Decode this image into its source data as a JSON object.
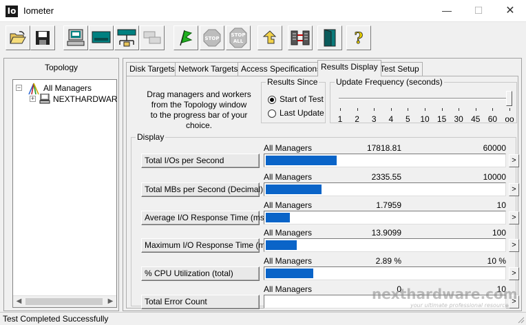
{
  "window": {
    "app_icon_text": "Io",
    "title": "Iometer",
    "minimize": "—",
    "maximize": "☐",
    "close": "✕"
  },
  "toolbar": {
    "buttons": [
      {
        "name": "open-config-button",
        "icon": "open-folder-icon"
      },
      {
        "name": "save-config-button",
        "icon": "floppy-disk-icon"
      },
      {
        "name": "new-manager-button",
        "icon": "computer-icon"
      },
      {
        "name": "new-disk-worker-button",
        "icon": "disk-worker-icon"
      },
      {
        "name": "new-network-worker-button",
        "icon": "network-worker-icon"
      },
      {
        "name": "duplicate-worker-button",
        "icon": "duplicate-icon",
        "disabled": true
      },
      {
        "name": "start-tests-button",
        "icon": "green-flag-icon"
      },
      {
        "name": "stop-button",
        "icon": "stop-sign-icon",
        "label": "STOP",
        "disabled": true
      },
      {
        "name": "stop-all-button",
        "icon": "stop-all-icon",
        "label_top": "STOP",
        "label_bottom": "ALL",
        "disabled": true
      },
      {
        "name": "reset-workers-button",
        "icon": "reset-arrow-icon"
      },
      {
        "name": "disconnect-managers-button",
        "icon": "disconnect-icon"
      },
      {
        "name": "exit-button",
        "icon": "exit-door-icon"
      },
      {
        "name": "help-button",
        "icon": "help-question-icon",
        "label": "?"
      }
    ]
  },
  "topology": {
    "title": "Topology",
    "root": "All Managers",
    "manager": "NEXTHARDWAR"
  },
  "tabs": [
    {
      "label": "Disk Targets",
      "active": false
    },
    {
      "label": "Network Targets",
      "active": false
    },
    {
      "label": "Access Specifications",
      "active": false
    },
    {
      "label": "Results Display",
      "active": true
    },
    {
      "label": "Test Setup",
      "active": false
    }
  ],
  "results_display": {
    "instructions": [
      "Drag managers and workers",
      "from the Topology window",
      "to the progress bar of your choice."
    ],
    "results_since": {
      "title": "Results Since",
      "options": [
        {
          "label": "Start of Test",
          "checked": true
        },
        {
          "label": "Last Update",
          "checked": false
        }
      ]
    },
    "update_frequency": {
      "title": "Update Frequency (seconds)",
      "ticks": [
        "1",
        "2",
        "3",
        "4",
        "5",
        "10",
        "15",
        "30",
        "45",
        "60",
        "oo"
      ],
      "selected": "oo"
    },
    "display_title": "Display",
    "metrics": [
      {
        "label": "Total I/Os per Second",
        "source": "All Managers",
        "value": "17818.81",
        "max": "60000",
        "fraction": 0.297
      },
      {
        "label": "Total MBs per Second (Decimal)",
        "source": "All Managers",
        "value": "2335.55",
        "max": "10000",
        "fraction": 0.234
      },
      {
        "label": "Average I/O Response Time (ms)",
        "source": "All Managers",
        "value": "1.7959",
        "max": "10",
        "fraction": 0.1
      },
      {
        "label": "Maximum I/O Response Time (ms)",
        "source": "All Managers",
        "value": "13.9099",
        "max": "100",
        "fraction": 0.131
      },
      {
        "label": "% CPU Utilization (total)",
        "source": "All Managers",
        "value": "2.89 %",
        "max": "10 %",
        "fraction": 0.2
      },
      {
        "label": "Total Error Count",
        "source": "All Managers",
        "value": "0",
        "max": "10",
        "fraction": 0
      }
    ],
    "arrow": ">"
  },
  "status": {
    "text": "Test Completed Successfully"
  },
  "watermark": {
    "text": "nexthardware.com",
    "tagline": "your ultimate professional resource"
  },
  "colors": {
    "progress_fill": "#0a64c8"
  }
}
